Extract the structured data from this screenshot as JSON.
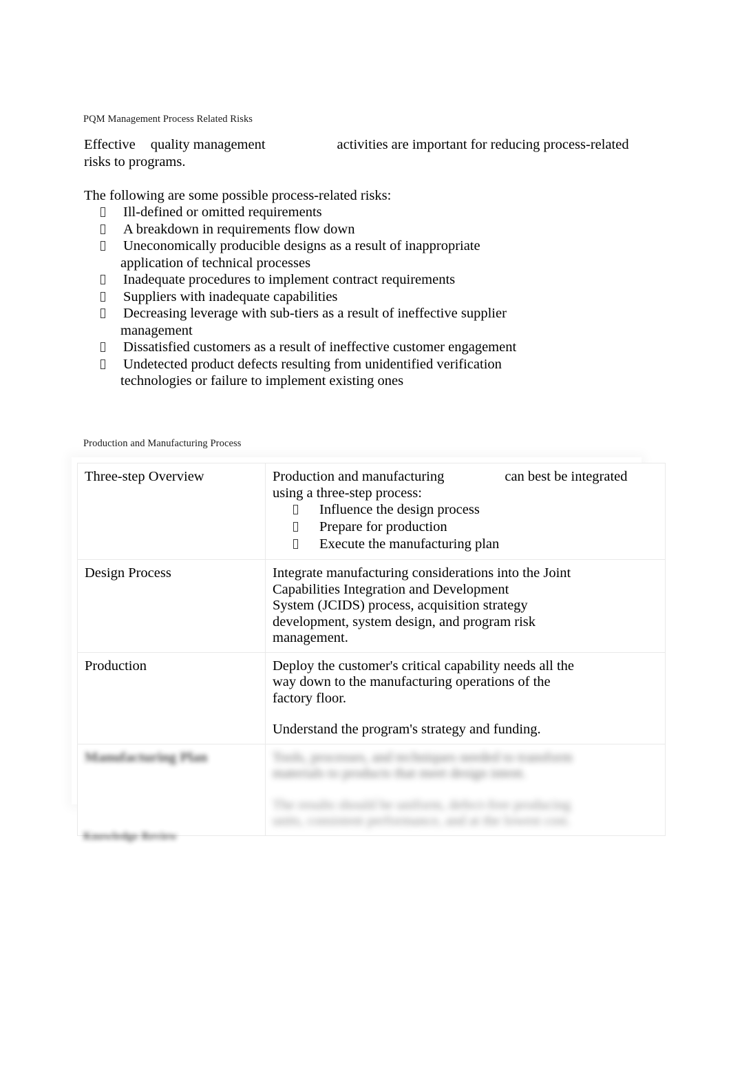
{
  "document": {
    "section_heading": "PQM Management Process Related Risks",
    "intro": {
      "part1": "Effective",
      "part2": "quality management",
      "part3": "activities are important for reducing process-related risks to programs."
    },
    "risks_lead_in": "The following are some possible process-related risks:",
    "risks": [
      "Ill-defined or omitted requirements",
      "A breakdown in requirements flow down",
      "Uneconomically producible designs as a result of inappropriate application of technical processes",
      "Inadequate procedures to implement contract requirements",
      "Suppliers with inadequate capabilities",
      "Decreasing leverage with sub-tiers as a result of ineffective supplier management",
      "Dissatisfied customers as a result of ineffective customer engagement",
      "Undetected product defects resulting from unidentified verification technologies or failure to implement existing ones"
    ],
    "risks_wrapped": [
      {
        "line1": "Ill-defined or omitted requirements",
        "line2": ""
      },
      {
        "line1": "A breakdown in requirements flow down",
        "line2": ""
      },
      {
        "line1": "Uneconomically producible designs as a result of inappropriate",
        "line2": "application of technical processes"
      },
      {
        "line1": "Inadequate procedures to implement contract requirements",
        "line2": ""
      },
      {
        "line1": "Suppliers with inadequate capabilities",
        "line2": ""
      },
      {
        "line1": "Decreasing leverage with sub-tiers as a result of ineffective supplier",
        "line2": "management"
      },
      {
        "line1": "Dissatisfied customers as a result of ineffective customer engagement",
        "line2": ""
      },
      {
        "line1": "Undetected product defects resulting from unidentified verification",
        "line2": "technologies or failure to implement existing ones"
      }
    ],
    "table_heading": "Production and Manufacturing Process",
    "table": {
      "rows": [
        {
          "label": "Three-step Overview",
          "body_part1": "Production and manufacturing",
          "body_part2": "can best be integrated using a three-step process:",
          "bullets": [
            "Influence the design process",
            "Prepare for production",
            "Execute the manufacturing plan"
          ]
        },
        {
          "label": "Design Process",
          "body_lines": [
            "Integrate manufacturing considerations into the Joint",
            "Capabilities Integration and Development",
            "System (JCIDS) process, acquisition strategy",
            "development, system design, and program risk",
            "management."
          ]
        },
        {
          "label": "Production",
          "body_lines": [
            "Deploy the customer's critical capability needs all the",
            "way down to the manufacturing operations of the",
            "factory floor."
          ],
          "body_extra": "Understand the program's strategy and funding."
        },
        {
          "label": "Manufacturing Plan",
          "redacted": true,
          "body_lines": [
            "Tools, processes, and techniques needed to transform",
            "materials to products that meet design intent.",
            "",
            "The results should be uniform, defect-free producing",
            "units, consistent performance, and at the lowest cost."
          ]
        }
      ]
    },
    "footer_heading": "Knowledge Review"
  }
}
